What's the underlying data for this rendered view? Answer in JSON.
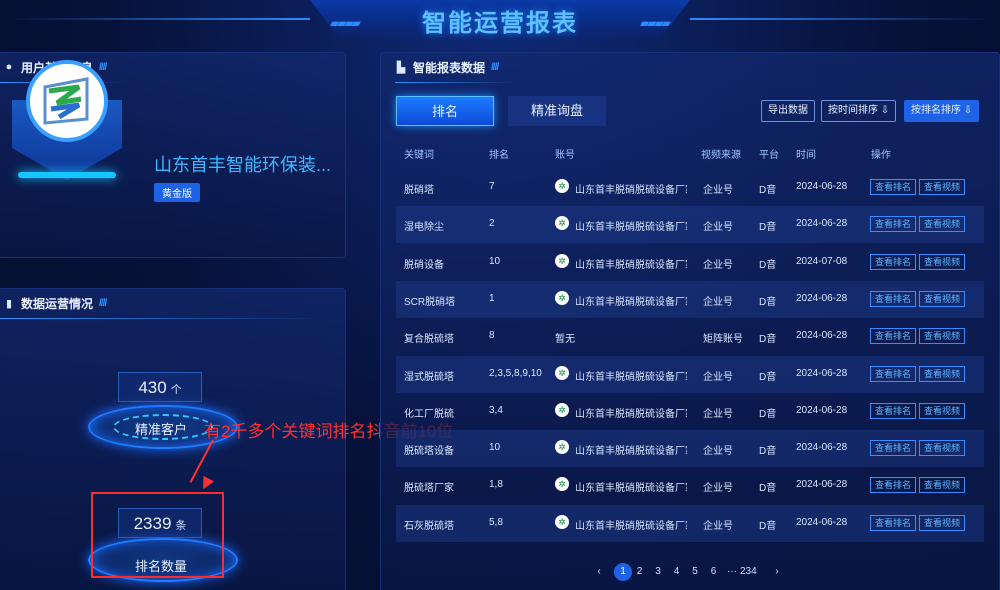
{
  "header": {
    "title": "智能运营报表"
  },
  "user_info": {
    "title": "用户基本信息",
    "icon": "user-icon",
    "company": "山东首丰智能环保装...",
    "badge": "黄金版"
  },
  "ops": {
    "title": "数据运营情况",
    "icon": "bar-chart-icon",
    "stats": [
      {
        "value": "430",
        "unit": "个",
        "label": "精准客户"
      },
      {
        "value": "2339",
        "unit": "条",
        "label": "排名数量"
      }
    ],
    "annotation": "有2千多个关键词排名抖音前10位"
  },
  "report": {
    "title": "智能报表数据",
    "icon": "chart-icon",
    "tabs": [
      "排名",
      "精准询盘"
    ],
    "actions": {
      "export": "导出数据",
      "sort_time": "按时间排序 ⇩",
      "sort_rank": "按排名排序 ⇩"
    },
    "columns": [
      "关键词",
      "排名",
      "账号",
      "视频来源",
      "平台",
      "时间",
      "操作"
    ],
    "rows": [
      {
        "keyword": "脱硝塔",
        "rank": "7",
        "account": "山东首丰脱硝脱硫设备厂家",
        "source": "企业号",
        "platform": "D音",
        "date": "2024-06-28",
        "op1": "查看排名",
        "op2": "查看视频"
      },
      {
        "keyword": "湿电除尘",
        "rank": "2",
        "account": "山东首丰脱硝脱硫设备厂家",
        "source": "企业号",
        "platform": "D音",
        "date": "2024-06-28",
        "op1": "查看排名",
        "op2": "查看视频"
      },
      {
        "keyword": "脱硝设备",
        "rank": "10",
        "account": "山东首丰脱硝脱硫设备厂家",
        "source": "企业号",
        "platform": "D音",
        "date": "2024-07-08",
        "op1": "查看排名",
        "op2": "查看视频"
      },
      {
        "keyword": "SCR脱硝塔",
        "rank": "1",
        "account": "山东首丰脱硝脱硫设备厂家",
        "source": "企业号",
        "platform": "D音",
        "date": "2024-06-28",
        "op1": "查看排名",
        "op2": "查看视频"
      },
      {
        "keyword": "复合脱硫塔",
        "rank": "8",
        "account": "暂无",
        "source": "矩阵账号",
        "platform": "D音",
        "date": "2024-06-28",
        "op1": "查看排名",
        "op2": "查看视频"
      },
      {
        "keyword": "湿式脱硫塔",
        "rank": "2,3,5,8,9,10",
        "account": "山东首丰脱硝脱硫设备厂家",
        "source": "企业号",
        "platform": "D音",
        "date": "2024-06-28",
        "op1": "查看排名",
        "op2": "查看视频"
      },
      {
        "keyword": "化工厂脱硫",
        "rank": "3,4",
        "account": "山东首丰脱硝脱硫设备厂家",
        "source": "企业号",
        "platform": "D音",
        "date": "2024-06-28",
        "op1": "查看排名",
        "op2": "查看视频"
      },
      {
        "keyword": "脱硫塔设备",
        "rank": "10",
        "account": "山东首丰脱硝脱硫设备厂家",
        "source": "企业号",
        "platform": "D音",
        "date": "2024-06-28",
        "op1": "查看排名",
        "op2": "查看视频"
      },
      {
        "keyword": "脱硫塔厂家",
        "rank": "1,8",
        "account": "山东首丰脱硝脱硫设备厂家",
        "source": "企业号",
        "platform": "D音",
        "date": "2024-06-28",
        "op1": "查看排名",
        "op2": "查看视频"
      },
      {
        "keyword": "石灰脱硫塔",
        "rank": "5,8",
        "account": "山东首丰脱硝脱硫设备厂家",
        "source": "企业号",
        "platform": "D音",
        "date": "2024-06-28",
        "op1": "查看排名",
        "op2": "查看视频"
      }
    ],
    "pagination": {
      "prev": "‹",
      "pages": [
        "1",
        "2",
        "3",
        "4",
        "5",
        "6"
      ],
      "ellipsis": "···",
      "last": "234",
      "next": "›",
      "current": "1"
    }
  }
}
